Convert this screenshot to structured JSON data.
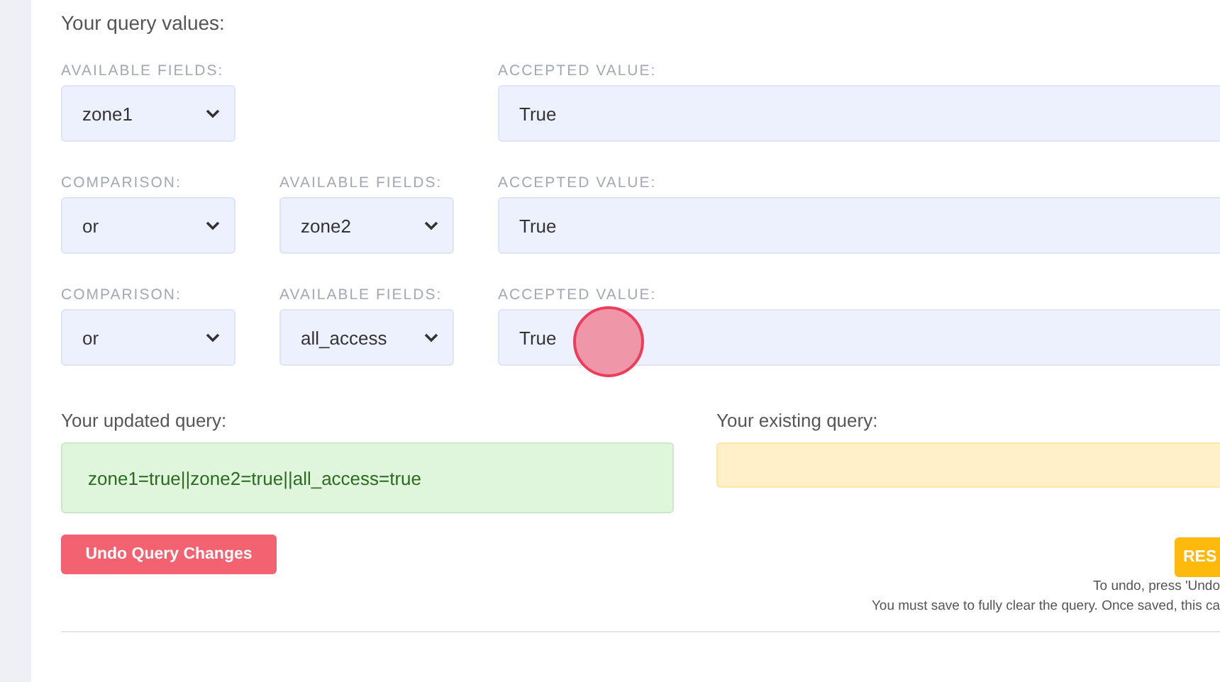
{
  "section_title": "Your query values:",
  "query_rows": [
    {
      "field_label": "AVAILABLE FIELDS:",
      "field": "zone1",
      "value_label": "ACCEPTED VALUE:",
      "value": "True"
    },
    {
      "comparison_label": "COMPARISON:",
      "comparison": "or",
      "field_label": "AVAILABLE FIELDS:",
      "field": "zone2",
      "value_label": "ACCEPTED VALUE:",
      "value": "True"
    },
    {
      "comparison_label": "COMPARISON:",
      "comparison": "or",
      "field_label": "AVAILABLE FIELDS:",
      "field": "all_access",
      "value_label": "ACCEPTED VALUE:",
      "value": "True"
    }
  ],
  "updated_query": {
    "label": "Your updated query:",
    "value": "zone1=true||zone2=true||all_access=true"
  },
  "existing_query": {
    "label": "Your existing query:"
  },
  "undo_button": "Undo Query Changes",
  "reset_button": "RES",
  "notes": [
    "To undo, press 'Undo",
    "You must save to fully clear the query. Once saved, this ca"
  ]
}
